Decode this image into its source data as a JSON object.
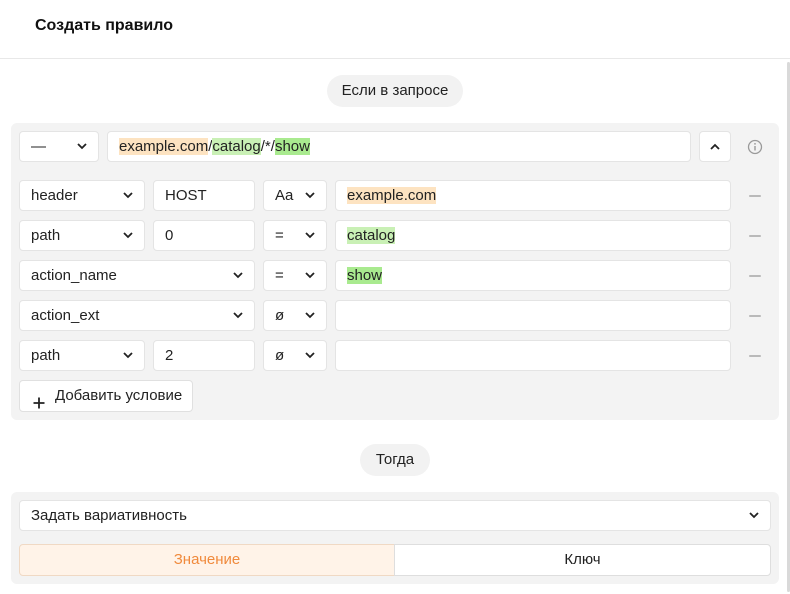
{
  "page": {
    "title": "Создать правило"
  },
  "if_section": {
    "label": "Если в запросе"
  },
  "url_row": {
    "type_select": "—",
    "pattern": {
      "host": "example.com",
      "sep1": "/",
      "catalog": "catalog",
      "middle": "/*/",
      "action": "show"
    }
  },
  "conditions": [
    {
      "param": "header",
      "key": "HOST",
      "op": "Aa",
      "value": "example.com"
    },
    {
      "param": "path",
      "key": "0",
      "op": "=",
      "value": "catalog"
    },
    {
      "param": "action_name",
      "op": "=",
      "value": "show"
    },
    {
      "param": "action_ext",
      "op": "ø",
      "value": ""
    },
    {
      "param": "path",
      "key": "2",
      "op": "ø",
      "value": ""
    }
  ],
  "add_condition_label": "Добавить условие",
  "then_section": {
    "label": "Тогда"
  },
  "action_select": "Задать вариативность",
  "segmented": {
    "value_label": "Значение",
    "key_label": "Ключ"
  },
  "colors": {
    "accent_orange": "#f08a3c",
    "highlight_orange": "#fde3c1",
    "highlight_green": "#c9f0b5",
    "panel_bg": "#f3f3f3"
  }
}
